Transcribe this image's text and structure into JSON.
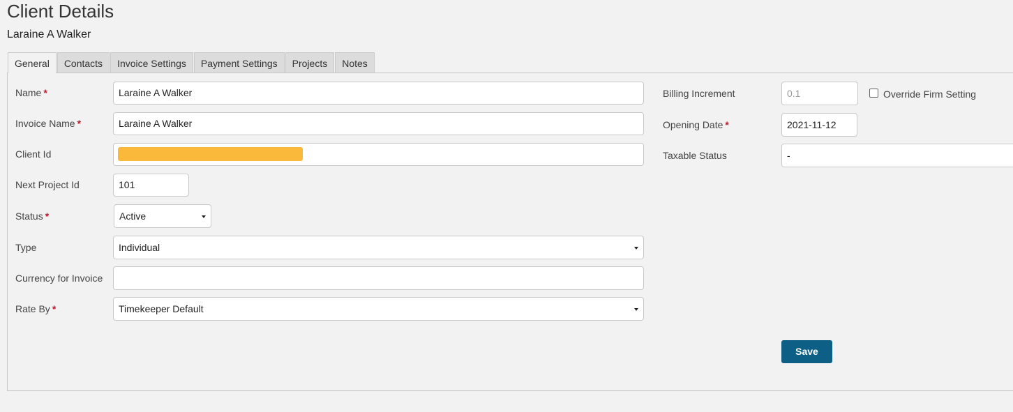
{
  "page": {
    "title": "Client Details",
    "client_name": "Laraine A Walker"
  },
  "tabs": [
    {
      "label": "General",
      "active": true
    },
    {
      "label": "Contacts",
      "active": false
    },
    {
      "label": "Invoice Settings",
      "active": false
    },
    {
      "label": "Payment Settings",
      "active": false
    },
    {
      "label": "Projects",
      "active": false
    },
    {
      "label": "Notes",
      "active": false
    }
  ],
  "form_left": {
    "name": {
      "label": "Name",
      "required": true,
      "value": "Laraine A Walker"
    },
    "invoice_name": {
      "label": "Invoice Name",
      "required": true,
      "value": "Laraine A Walker"
    },
    "client_id": {
      "label": "Client Id",
      "required": false,
      "value": "",
      "redacted": true
    },
    "next_project_id": {
      "label": "Next Project Id",
      "required": false,
      "value": "101"
    },
    "status": {
      "label": "Status",
      "required": true,
      "value": "Active"
    },
    "type": {
      "label": "Type",
      "required": false,
      "value": "Individual"
    },
    "currency": {
      "label": "Currency for Invoice",
      "required": false,
      "value": ""
    },
    "rate_by": {
      "label": "Rate By",
      "required": true,
      "value": "Timekeeper Default"
    }
  },
  "form_right": {
    "billing_increment": {
      "label": "Billing Increment",
      "required": false,
      "value": "0.1"
    },
    "override_firm_setting": {
      "label": "Override Firm Setting",
      "checked": false
    },
    "opening_date": {
      "label": "Opening Date",
      "required": true,
      "value": "2021-11-12"
    },
    "taxable_status": {
      "label": "Taxable Status",
      "required": false,
      "value": "-"
    }
  },
  "actions": {
    "save_label": "Save"
  },
  "required_marker": "*",
  "colors": {
    "background": "#f2f2f2",
    "required": "#c0192e",
    "save_button": "#0d5f86",
    "redaction": "#fbb93c"
  }
}
